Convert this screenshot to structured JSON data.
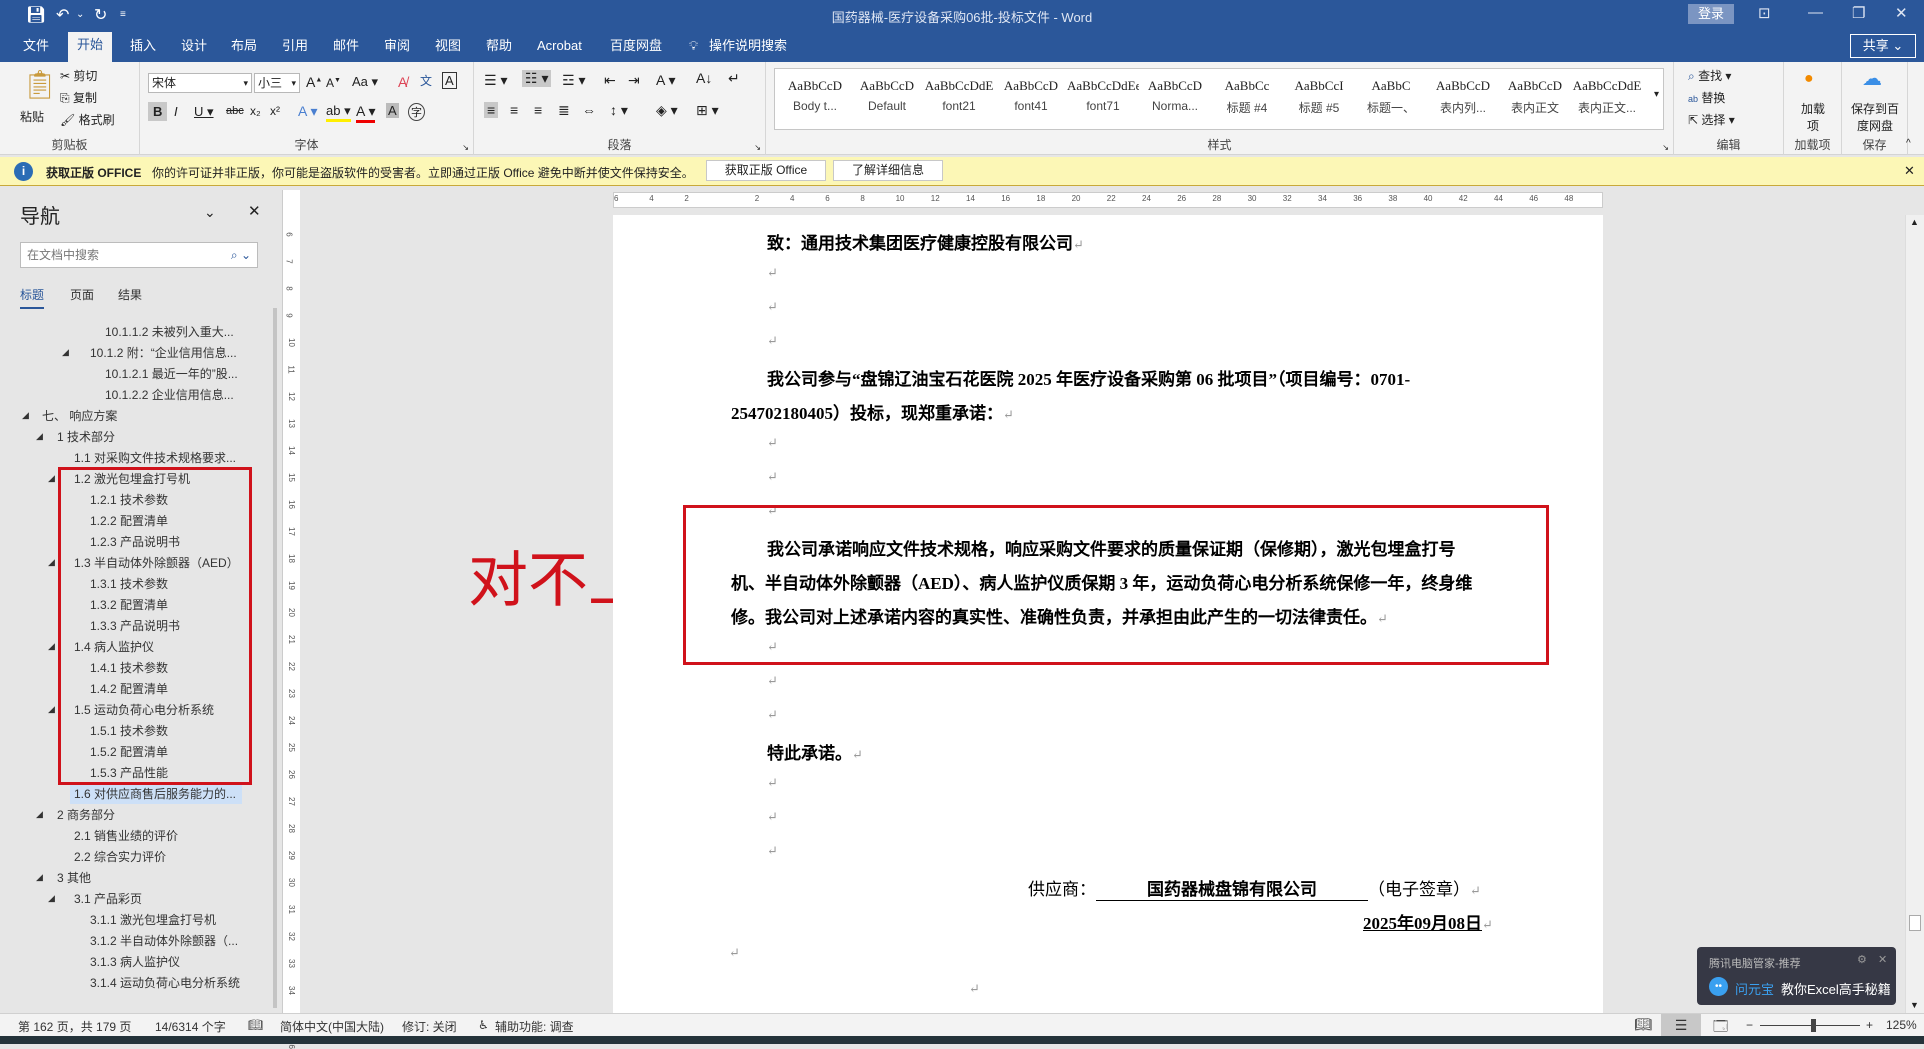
{
  "window": {
    "title": "国药器械-医疗设备采购06批-投标文件  -  Word",
    "login": "登录",
    "share": "共享"
  },
  "tabs": [
    "文件",
    "开始",
    "插入",
    "设计",
    "布局",
    "引用",
    "邮件",
    "审阅",
    "视图",
    "帮助",
    "Acrobat",
    "百度网盘",
    "操作说明搜索"
  ],
  "ribbon": {
    "clipboard": {
      "paste": "粘贴",
      "cut": "剪切",
      "copy": "复制",
      "format_painter": "格式刷",
      "label": "剪贴板"
    },
    "font": {
      "name": "宋体",
      "size": "小三",
      "label": "字体"
    },
    "paragraph": {
      "label": "段落"
    },
    "styles": {
      "label": "样式",
      "items": [
        {
          "preview": "AaBbCcD",
          "name": "Body t..."
        },
        {
          "preview": "AaBbCcD",
          "name": "Default"
        },
        {
          "preview": "AaBbCcDdE",
          "name": "font21"
        },
        {
          "preview": "AaBbCcD",
          "name": "font41"
        },
        {
          "preview": "AaBbCcDdEe",
          "name": "font71"
        },
        {
          "preview": "AaBbCcD",
          "name": "Norma..."
        },
        {
          "preview": "AaBbCc",
          "name": "标题 #4"
        },
        {
          "preview": "AaBbCcI",
          "name": "标题 #5"
        },
        {
          "preview": "AaBbC",
          "name": "标题一、"
        },
        {
          "preview": "AaBbCcD",
          "name": "表内列..."
        },
        {
          "preview": "AaBbCcD",
          "name": "表内正文"
        },
        {
          "preview": "AaBbCcDdE",
          "name": "表内正文..."
        }
      ]
    },
    "editing": {
      "find": "查找",
      "replace": "替换",
      "select": "选择",
      "label": "编辑"
    },
    "addins": {
      "button": "加载项",
      "label": "加载项"
    },
    "save": {
      "button": "保存到百度网盘",
      "label": "保存"
    }
  },
  "infobar": {
    "title": "获取正版 OFFICE",
    "message": "你的许可证并非正版，你可能是盗版软件的受害者。立即通过正版 Office 避免中断并使文件保持安全。",
    "btn1": "获取正版 Office",
    "btn2": "了解详细信息"
  },
  "nav": {
    "title": "导航",
    "search_placeholder": "在文档中搜索",
    "tabs": [
      "标题",
      "页面",
      "结果"
    ],
    "items": [
      {
        "text": "10.1.1.2 未被列入重大...",
        "level": 5,
        "tri": false
      },
      {
        "text": "10.1.2 附：“企业信用信息...",
        "level": 4,
        "tri": true
      },
      {
        "text": "10.1.2.1 最近一年的”股...",
        "level": 5,
        "tri": false
      },
      {
        "text": "10.1.2.2 企业信用信息...",
        "level": 5,
        "tri": false
      },
      {
        "text": "七、 响应方案",
        "level": 1,
        "tri": true
      },
      {
        "text": "1 技术部分",
        "level": 2,
        "tri": true
      },
      {
        "text": "1.1 对采购文件技术规格要求...",
        "level": 3,
        "tri": false
      },
      {
        "text": "1.2 激光包埋盒打号机",
        "level": 3,
        "tri": true
      },
      {
        "text": "1.2.1 技术参数",
        "level": 4,
        "tri": false
      },
      {
        "text": "1.2.2 配置清单",
        "level": 4,
        "tri": false
      },
      {
        "text": "1.2.3 产品说明书",
        "level": 4,
        "tri": false
      },
      {
        "text": "1.3 半自动体外除颤器（AED）",
        "level": 3,
        "tri": true
      },
      {
        "text": "1.3.1 技术参数",
        "level": 4,
        "tri": false
      },
      {
        "text": "1.3.2 配置清单",
        "level": 4,
        "tri": false
      },
      {
        "text": "1.3.3 产品说明书",
        "level": 4,
        "tri": false
      },
      {
        "text": "1.4 病人监护仪",
        "level": 3,
        "tri": true
      },
      {
        "text": "1.4.1 技术参数",
        "level": 4,
        "tri": false
      },
      {
        "text": "1.4.2 配置清单",
        "level": 4,
        "tri": false
      },
      {
        "text": "1.5 运动负荷心电分析系统",
        "level": 3,
        "tri": true
      },
      {
        "text": "1.5.1 技术参数",
        "level": 4,
        "tri": false
      },
      {
        "text": "1.5.2 配置清单",
        "level": 4,
        "tri": false
      },
      {
        "text": "1.5.3 产品性能",
        "level": 4,
        "tri": false
      },
      {
        "text": "1.6 对供应商售后服务能力的...",
        "level": 3,
        "tri": false,
        "selected": true
      },
      {
        "text": "2 商务部分",
        "level": 2,
        "tri": true
      },
      {
        "text": "2.1 销售业绩的评价",
        "level": 3,
        "tri": false
      },
      {
        "text": "2.2 综合实力评价",
        "level": 3,
        "tri": false
      },
      {
        "text": "3 其他",
        "level": 2,
        "tri": true
      },
      {
        "text": "3.1 产品彩页",
        "level": 3,
        "tri": true
      },
      {
        "text": "3.1.1 激光包埋盒打号机",
        "level": 4,
        "tri": false
      },
      {
        "text": "3.1.2 半自动体外除颤器（...",
        "level": 4,
        "tri": false
      },
      {
        "text": "3.1.3 病人监护仪",
        "level": 4,
        "tri": false
      },
      {
        "text": "3.1.4 运动负荷心电分析系统",
        "level": 4,
        "tri": false
      }
    ]
  },
  "annotation": {
    "text": "对不上",
    "color": "#d0121b"
  },
  "document": {
    "to": "致：通用技术集团医疗健康控股有限公司",
    "para1_line1": "我公司参与“盘锦辽油宝石花医院 2025 年医疗设备采购第 06 批项目”（项目编号：0701-",
    "para1_line2": "254702180405）投标，现郑重承诺：",
    "para2_line1": "我公司承诺响应文件技术规格，响应采购文件要求的质量保证期（保修期），激光包埋盒打号",
    "para2_line2": "机、半自动体外除颤器（AED）、病人监护仪质保期 3 年，运动负荷心电分析系统保修一年，终身维",
    "para2_line3": "修。我公司对上述承诺内容的真实性、准确性负责，并承担由此产生的一切法律责任。",
    "closing": "特此承诺。",
    "supplier_label": "供应商：",
    "supplier_name": "国药器械盘锦有限公司",
    "seal": "（电子签章）",
    "date": "2025年09月08日",
    "para_mark": "↵"
  },
  "status": {
    "page": "第 162 页，共 179 页",
    "words": "14/6314 个字",
    "language": "简体中文(中国大陆)",
    "track": "修订: 关闭",
    "accessibility": "辅助功能: 调查",
    "zoom": "125%",
    "zoom_fraction": 0.53
  },
  "toast": {
    "source": "腾讯电脑管家-推荐",
    "app": "问元宝",
    "message": "教你Excel高手秘籍"
  }
}
